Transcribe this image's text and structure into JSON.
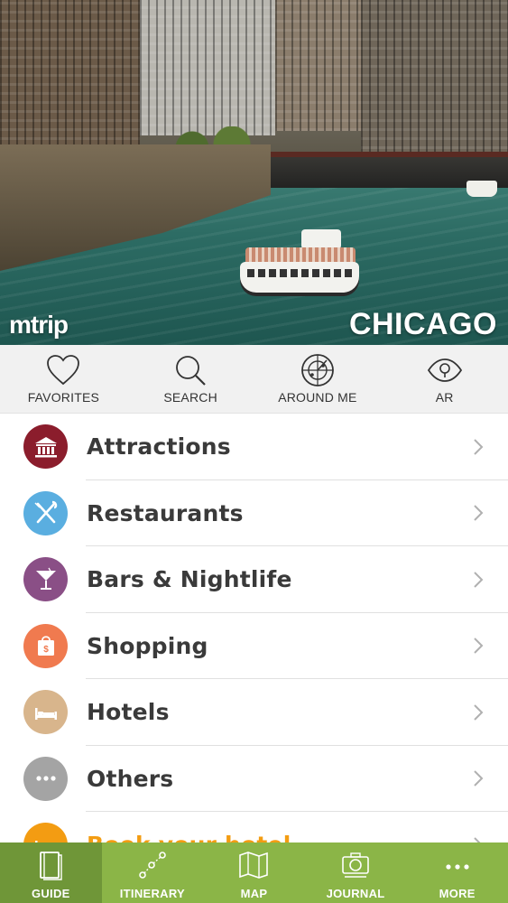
{
  "hero": {
    "brand": "mtrip",
    "city": "CHICAGO"
  },
  "quick_actions": [
    {
      "label": "FAVORITES",
      "icon": "heart-icon"
    },
    {
      "label": "SEARCH",
      "icon": "search-icon"
    },
    {
      "label": "AROUND ME",
      "icon": "radar-icon"
    },
    {
      "label": "AR",
      "icon": "eye-icon"
    }
  ],
  "categories": [
    {
      "label": "Attractions",
      "icon": "museum-icon",
      "color": "#8b1d2c"
    },
    {
      "label": "Restaurants",
      "icon": "utensils-icon",
      "color": "#5aaee0"
    },
    {
      "label": "Bars & Nightlife",
      "icon": "cocktail-icon",
      "color": "#8a4f86"
    },
    {
      "label": "Shopping",
      "icon": "shopping-bag-icon",
      "color": "#f07a4f"
    },
    {
      "label": "Hotels",
      "icon": "bed-icon",
      "color": "#d8b58c"
    },
    {
      "label": "Others",
      "icon": "ellipsis-icon",
      "color": "#a4a4a4"
    },
    {
      "label": "Book your hotel",
      "icon": "hotel-booking-icon",
      "color": "#f39c12"
    }
  ],
  "tabs": [
    {
      "label": "GUIDE",
      "icon": "book-icon",
      "active": true
    },
    {
      "label": "ITINERARY",
      "icon": "route-icon",
      "active": false
    },
    {
      "label": "MAP",
      "icon": "map-icon",
      "active": false
    },
    {
      "label": "JOURNAL",
      "icon": "camera-icon",
      "active": false
    },
    {
      "label": "MORE",
      "icon": "more-icon",
      "active": false
    }
  ],
  "colors": {
    "tabbar": "#8bb547",
    "tab_active": "#6f9638",
    "accent_orange": "#f39c12"
  }
}
